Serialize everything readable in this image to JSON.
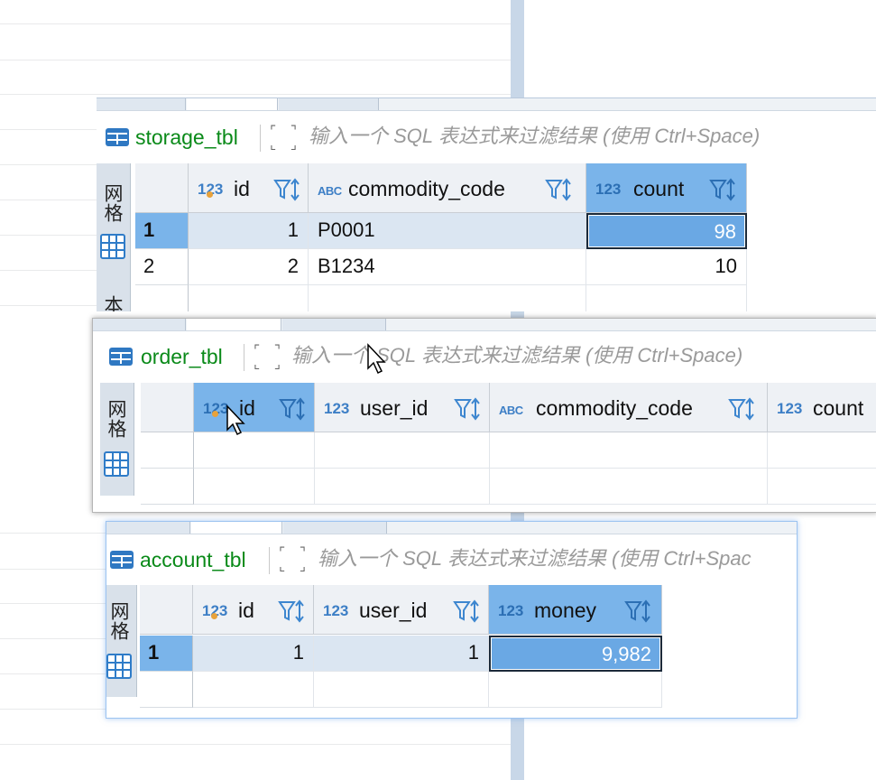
{
  "filter_placeholder": "输入一个 SQL 表达式来过滤结果 (使用 Ctrl+Space)",
  "filter_placeholder_truncated": "输入一个 SQL 表达式来过滤结果 (使用 Ctrl+Spac",
  "side_tab_grid": "网格",
  "side_tab_text_partial": "本",
  "type_num": "123",
  "type_text": "ABC",
  "storage": {
    "table_name": "storage_tbl",
    "columns": [
      {
        "type": "123",
        "name": "id",
        "key": true
      },
      {
        "type": "ABC",
        "name": "commodity_code"
      },
      {
        "type": "123",
        "name": "count",
        "selected": true
      }
    ],
    "rows": [
      {
        "num": "1",
        "id": "1",
        "commodity_code": "P0001",
        "count": "98"
      },
      {
        "num": "2",
        "id": "2",
        "commodity_code": "B1234",
        "count": "10"
      }
    ]
  },
  "order": {
    "table_name": "order_tbl",
    "columns": [
      {
        "type": "123",
        "name": "id",
        "key": true,
        "selected": true
      },
      {
        "type": "123",
        "name": "user_id"
      },
      {
        "type": "ABC",
        "name": "commodity_code"
      },
      {
        "type": "123",
        "name": "count"
      }
    ]
  },
  "account": {
    "table_name": "account_tbl",
    "columns": [
      {
        "type": "123",
        "name": "id",
        "key": true
      },
      {
        "type": "123",
        "name": "user_id"
      },
      {
        "type": "123",
        "name": "money",
        "selected": true
      }
    ],
    "rows": [
      {
        "num": "1",
        "id": "1",
        "user_id": "1",
        "money": "9,982"
      }
    ]
  },
  "colors": {
    "table_name": "#0a8a19",
    "header_selected": "#7ab4ea",
    "type_icon": "#3d7fc6",
    "cell_focus": "#6aa8e4"
  }
}
